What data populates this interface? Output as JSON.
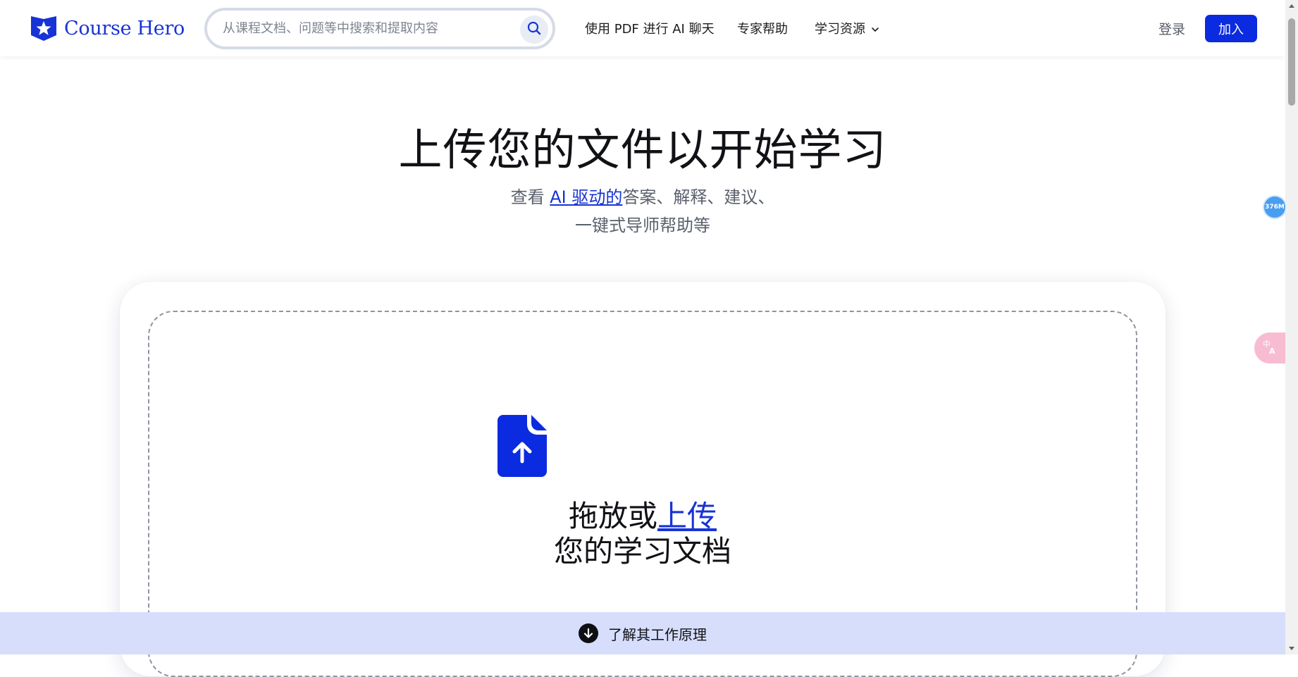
{
  "header": {
    "logo_text": "Course Hero",
    "search": {
      "placeholder": "从课程文档、问题等中搜索和提取内容",
      "value": ""
    },
    "nav": [
      {
        "label": "使用 PDF 进行 AI 聊天"
      },
      {
        "label": "专家帮助"
      },
      {
        "label": "学习资源"
      }
    ],
    "login_label": "登录",
    "join_label": "加入"
  },
  "hero": {
    "title": "上传您的文件以开始学习",
    "subtitle_prefix": "查看 ",
    "subtitle_link": "AI 驱动的",
    "subtitle_suffix": "答案、解释、建议、",
    "subtitle_line2": "一键式导师帮助等"
  },
  "upload": {
    "text_prefix": "拖放或",
    "text_link": "上传",
    "text_line2": "您的学习文档"
  },
  "banner": {
    "label": "了解其工作原理"
  },
  "widgets": {
    "memory_badge": "376M"
  },
  "colors": {
    "brand_blue": "#0b2be0",
    "link_blue": "#1733d6",
    "banner_bg": "#d6defc",
    "badge_blue": "#4a9ef0",
    "translate_pink": "#f7bcd2"
  },
  "icons": {
    "logo": "star-shield-icon",
    "search": "search-icon",
    "nav_dropdown": "chevron-down-icon",
    "upload": "file-upload-icon",
    "banner": "arrow-down-circle-icon",
    "translate": "translate-icon"
  }
}
